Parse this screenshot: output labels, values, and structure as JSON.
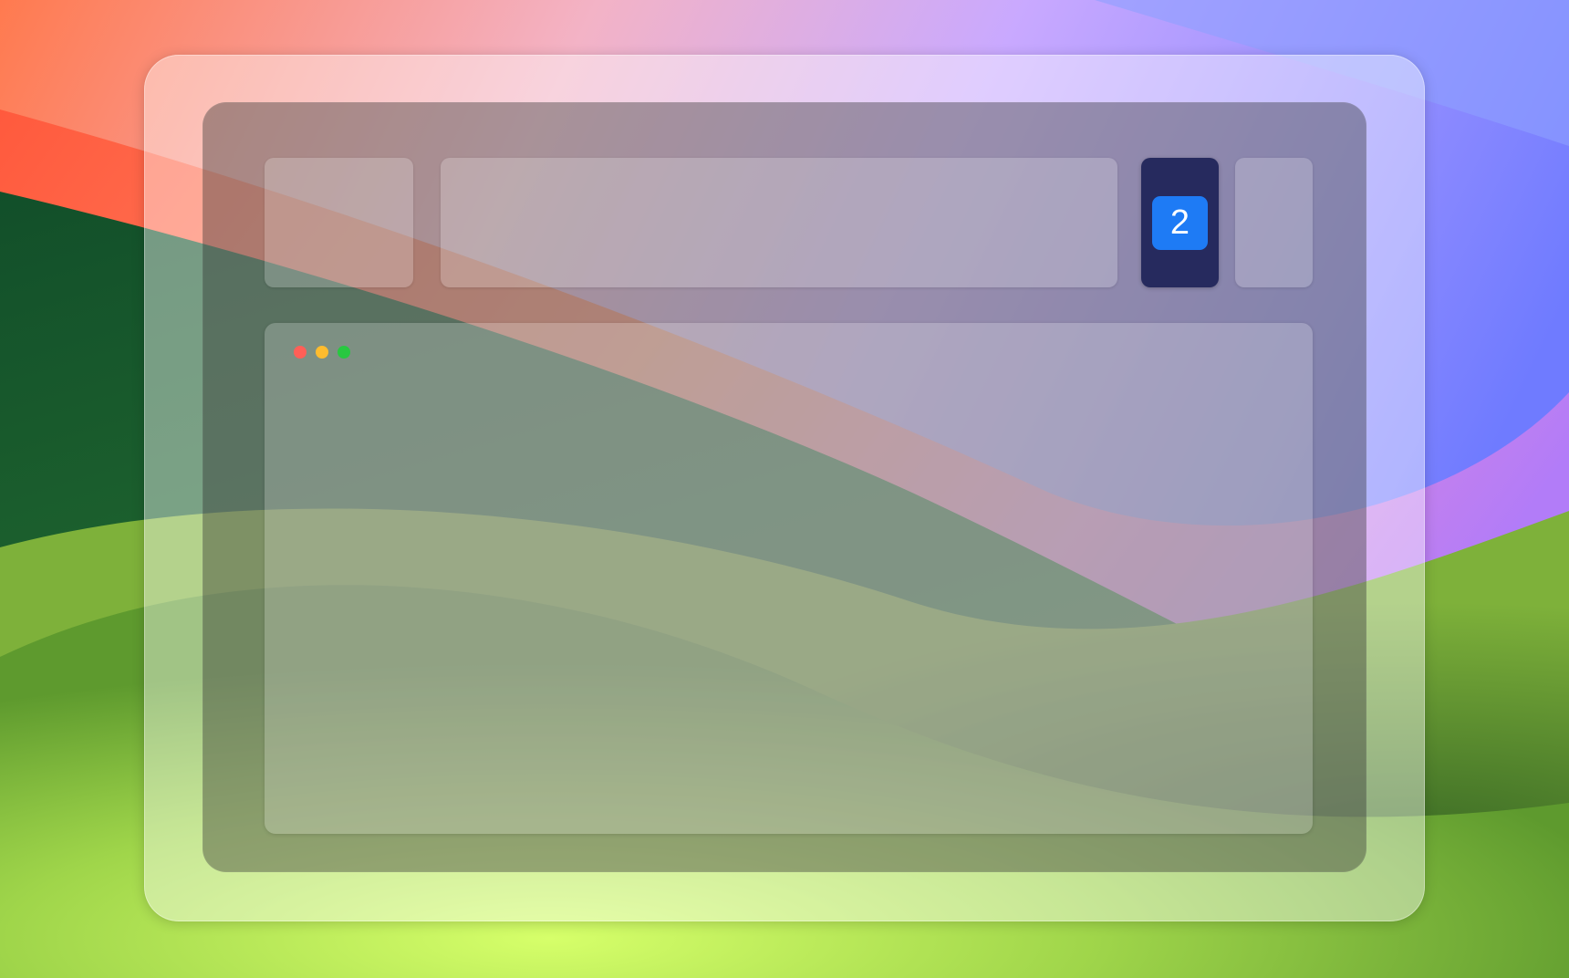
{
  "mission_control": {
    "active_space_number": "2"
  },
  "window": {
    "traffic_lights": {
      "close_color": "#ff5f57",
      "minimize_color": "#febc2e",
      "zoom_color": "#28c840"
    }
  },
  "colors": {
    "badge_blue": "#1e7bf5",
    "active_tile": "#262a5e"
  }
}
